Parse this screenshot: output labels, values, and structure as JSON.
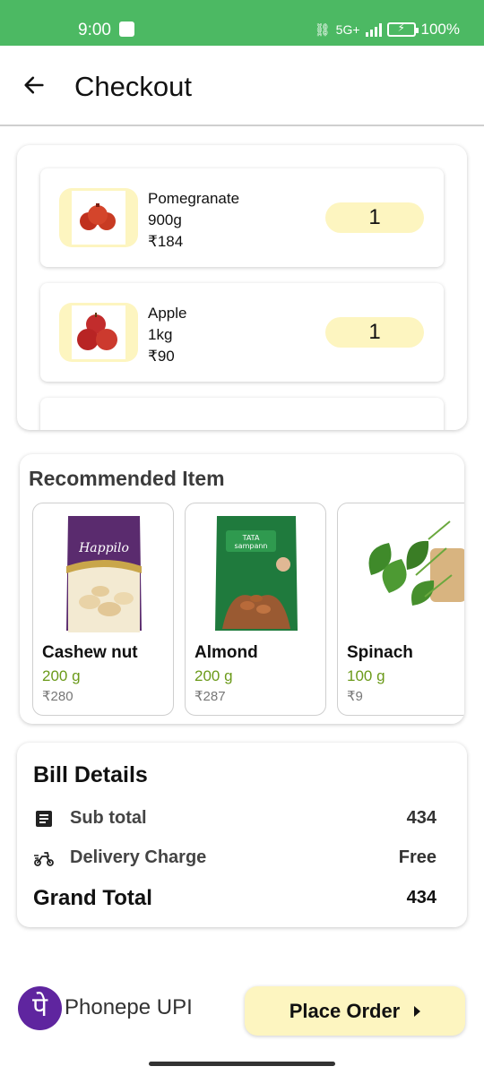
{
  "status_bar": {
    "time": "9:00",
    "battery": "100%",
    "network": "5G+"
  },
  "header": {
    "title": "Checkout"
  },
  "cart": {
    "items": [
      {
        "name": "Pomegranate",
        "weight": "900g",
        "price": "₹184",
        "qty": "1",
        "icon": "pomegranate-image"
      },
      {
        "name": "Apple",
        "weight": "1kg",
        "price": "₹90",
        "qty": "1",
        "icon": "apple-image"
      }
    ]
  },
  "recommended": {
    "title": "Recommended Item",
    "items": [
      {
        "name": "Cashew nut",
        "weight": "200 g",
        "price": "₹280",
        "brand": "Happilo",
        "icon": "cashew-pack-image"
      },
      {
        "name": "Almond",
        "weight": "200 g",
        "price": "₹287",
        "brand": "TATA sampann",
        "icon": "almond-pack-image"
      },
      {
        "name": "Spinach",
        "weight": "100 g",
        "price": "₹9",
        "icon": "spinach-image"
      }
    ]
  },
  "bill": {
    "title": "Bill Details",
    "subtotal_label": "Sub total",
    "subtotal_value": "434",
    "delivery_label": "Delivery Charge",
    "delivery_value": "Free",
    "grand_label": "Grand Total",
    "grand_value": "434"
  },
  "payment": {
    "method": "Phonepe UPI",
    "logo_glyph": "पे",
    "brand_color": "#5f259f"
  },
  "cta": {
    "label": "Place Order"
  },
  "colors": {
    "status_bar": "#4cb963",
    "accent_yellow": "#fdf5c0",
    "weight_green": "#6b9a1a"
  }
}
